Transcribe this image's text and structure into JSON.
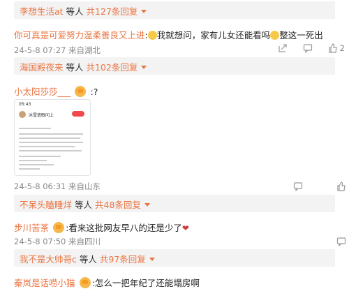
{
  "threads": [
    {
      "user": "李想生活at",
      "mid": "等人",
      "count": "共127条回复"
    },
    {
      "user": "海国殿夜来",
      "mid": "等人",
      "count": "共102条回复"
    },
    {
      "user": "不呆头瞌睡烊",
      "mid": "等人",
      "count": "共48条回复"
    },
    {
      "user": "我不是大帅哥c",
      "mid": "等人",
      "count": "共97条回复"
    }
  ],
  "comments": [
    {
      "name": "你可真是可爱努力温柔善良又上进",
      "sep": ":",
      "text_a": "我就想问，家有儿女还能看吗",
      "text_b": "整这一死出",
      "meta": "24-5-8 07:27 来自湖北",
      "like_count": "2"
    },
    {
      "name": "小太阳莎莎___",
      "text": ":?",
      "meta": "24-5-8 06:31 来自山东"
    },
    {
      "name": "步川苦茶",
      "text": ":看来这批网友早八的还是少了",
      "meta": "24-5-8 07:50 来自四川"
    },
    {
      "name": "秦岚是话唠小猫",
      "text": ":怎么一把年纪了还能塌房啊"
    }
  ],
  "screenshot": {
    "time": "05:43",
    "title": "冰雪遮眼问上"
  },
  "icons": [
    "share-icon",
    "comment-icon",
    "like-icon"
  ]
}
